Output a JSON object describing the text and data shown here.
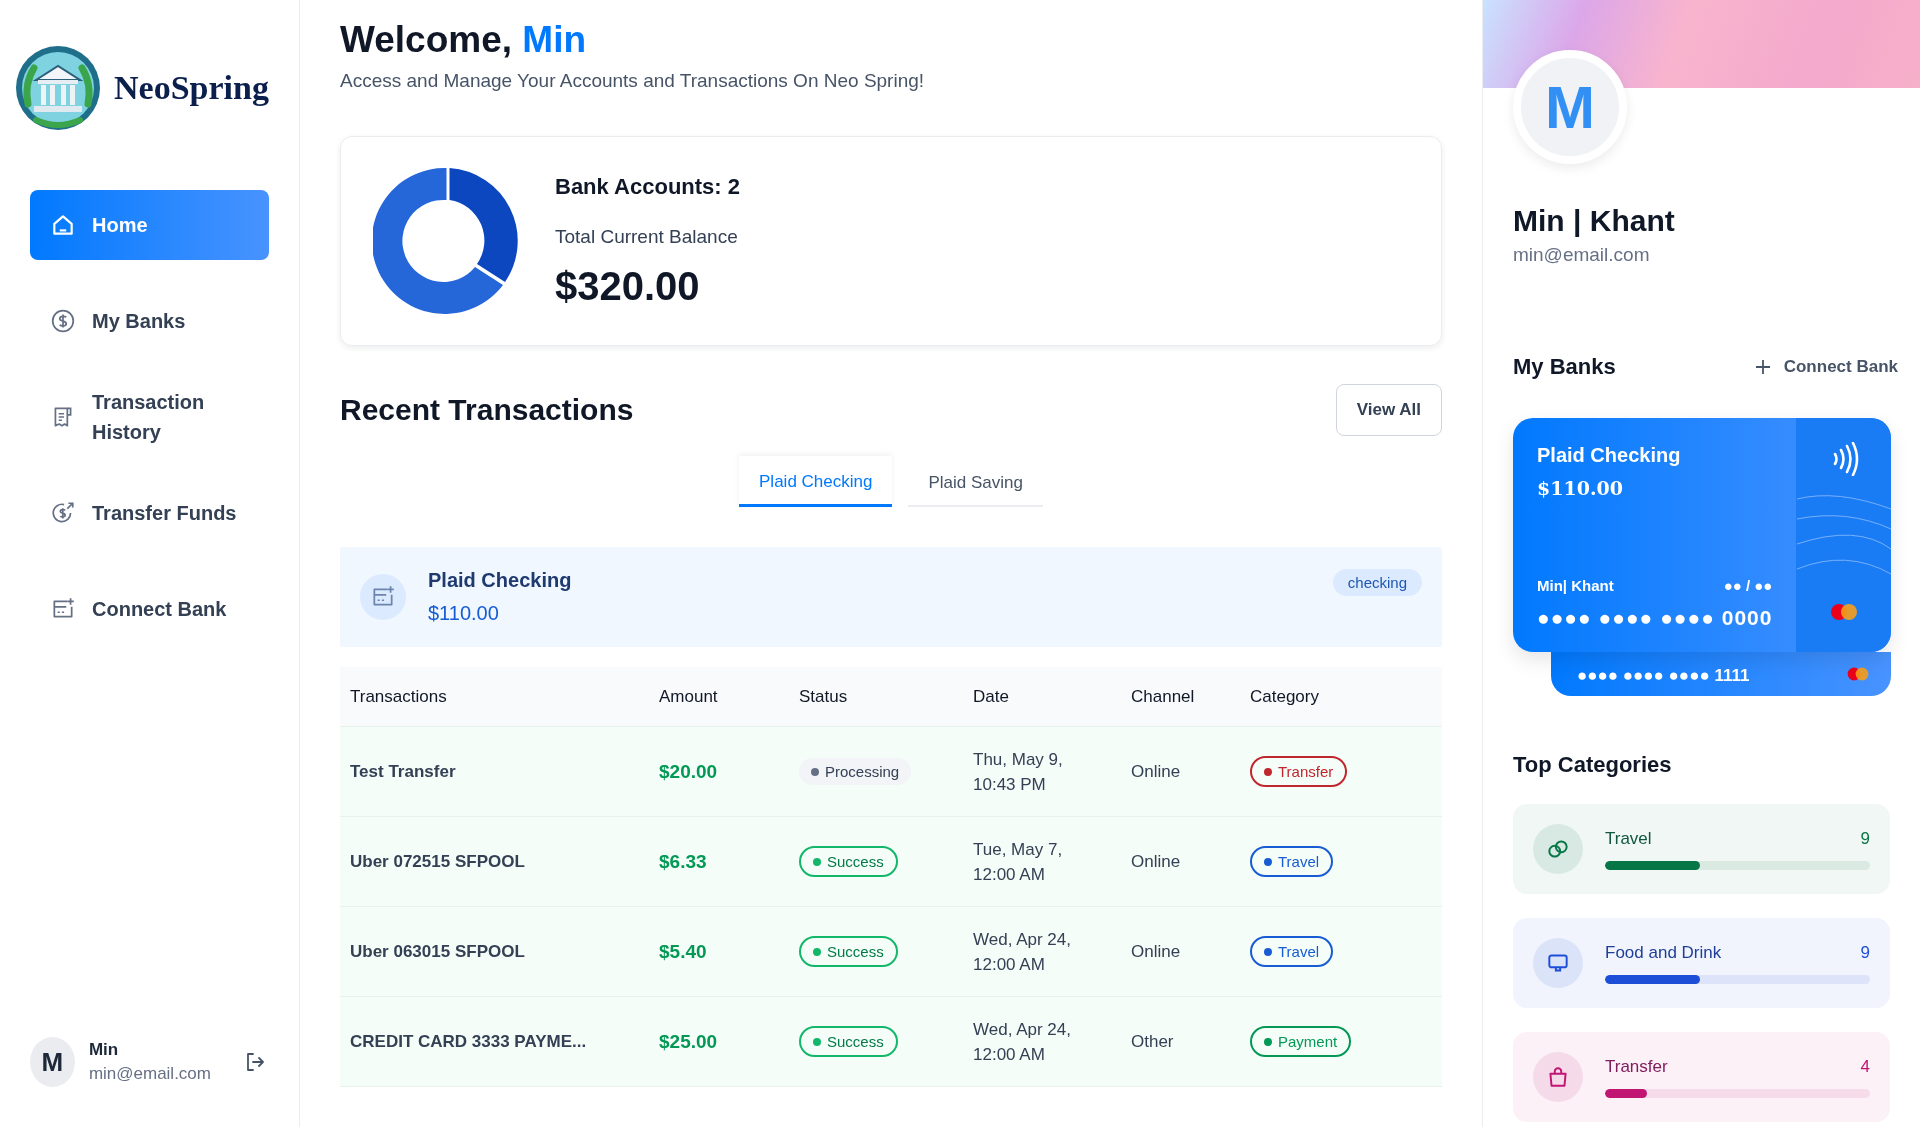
{
  "sidebar": {
    "brand": "NeoSpring",
    "nav": [
      {
        "label": "Home",
        "kind": "home",
        "selected": true
      },
      {
        "label": "My Banks",
        "kind": "dollar",
        "selected": false
      },
      {
        "label": "Transaction History",
        "kind": "receipt",
        "selected": false
      },
      {
        "label": "Transfer Funds",
        "kind": "transfer",
        "selected": false
      },
      {
        "label": "Connect Bank",
        "kind": "connect",
        "selected": false
      }
    ],
    "user": {
      "initial": "M",
      "name": "Min",
      "email": "min@email.com"
    }
  },
  "header": {
    "greeting": "Welcome,",
    "name": "Min",
    "subtitle": "Access and Manage Your Accounts and Transactions On Neo Spring!"
  },
  "balance": {
    "accounts": "Bank Accounts: 2",
    "label": "Total Current Balance",
    "amount": "$320.00"
  },
  "transactions": {
    "title": "Recent Transactions",
    "view_all": "View All",
    "tabs": [
      {
        "label": "Plaid Checking",
        "selected": true
      },
      {
        "label": "Plaid Saving",
        "selected": false
      }
    ],
    "account": {
      "name": "Plaid Checking",
      "balance": "$110.00",
      "type": "checking"
    },
    "columns": [
      "Transactions",
      "Amount",
      "Status",
      "Date",
      "Channel",
      "Category"
    ],
    "rows": [
      {
        "name": "Test Transfer",
        "amount": "$20.00",
        "status": {
          "label": "Processing",
          "kind": "processing"
        },
        "date": "Thu, May 9, 10:43 PM",
        "channel": "Online",
        "category": {
          "label": "Transfer",
          "color": "#c0262d"
        }
      },
      {
        "name": "Uber 072515 SFPOOL",
        "amount": "$6.33",
        "status": {
          "label": "Success",
          "kind": "success"
        },
        "date": "Tue, May 7, 12:00 AM",
        "channel": "Online",
        "category": {
          "label": "Travel",
          "color": "#175cd3"
        }
      },
      {
        "name": "Uber 063015 SFPOOL",
        "amount": "$5.40",
        "status": {
          "label": "Success",
          "kind": "success"
        },
        "date": "Wed, Apr 24, 12:00 AM",
        "channel": "Online",
        "category": {
          "label": "Travel",
          "color": "#175cd3"
        }
      },
      {
        "name": "CREDIT CARD 3333 PAYME...",
        "amount": "$25.00",
        "status": {
          "label": "Success",
          "kind": "success"
        },
        "date": "Wed, Apr 24, 12:00 AM",
        "channel": "Other",
        "category": {
          "label": "Payment",
          "color": "#039855"
        }
      }
    ]
  },
  "profile": {
    "initial": "M",
    "name": "Min | Khant",
    "email": "min@email.com"
  },
  "banks": {
    "title": "My Banks",
    "connect": "Connect Bank",
    "cards": [
      {
        "name": "Plaid Checking",
        "balance": "$110.00",
        "holder": "Min| Khant",
        "expiry": "●● / ●●",
        "number": "●●●● ●●●● ●●●● 0000"
      },
      {
        "number": "●●●● ●●●● ●●●● 1111"
      }
    ]
  },
  "categories": {
    "title": "Top Categories",
    "items": [
      {
        "name": "Travel",
        "count": "9",
        "level": 0.36,
        "color": "#067647",
        "kind": "travel"
      },
      {
        "name": "Food and Drink",
        "count": "9",
        "level": 0.36,
        "color": "#1d4ed8",
        "kind": "food"
      },
      {
        "name": "Transfer",
        "count": "4",
        "level": 0.16,
        "color": "#c11574",
        "kind": "transfer"
      }
    ]
  }
}
